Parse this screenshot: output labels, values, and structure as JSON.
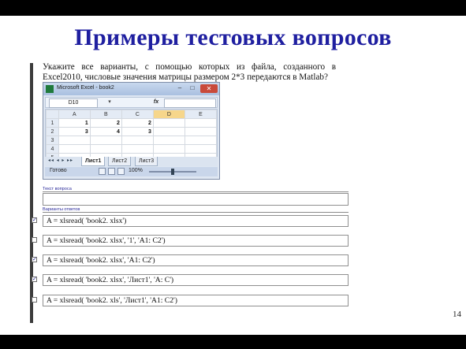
{
  "slide": {
    "title": "Примеры тестовых вопросов",
    "page_number": "14"
  },
  "question": {
    "line1": "Укажите все варианты, с помощью которых из файла, созданного в",
    "line2": "Excel2010, числовые значения матрицы размером 2*3 передаются в Matlab?"
  },
  "excel": {
    "window_title": "Microsoft Excel - book2",
    "name_box": "D10",
    "fx_label": "fx",
    "columns": [
      "A",
      "B",
      "C",
      "D",
      "E"
    ],
    "selected_column": "D",
    "rows": [
      {
        "num": "1",
        "cells": [
          "1",
          "2",
          "2",
          "",
          ""
        ]
      },
      {
        "num": "2",
        "cells": [
          "3",
          "4",
          "3",
          "",
          ""
        ]
      },
      {
        "num": "3",
        "cells": [
          "",
          "",
          "",
          "",
          ""
        ]
      },
      {
        "num": "4",
        "cells": [
          "",
          "",
          "",
          "",
          ""
        ]
      },
      {
        "num": "5",
        "cells": [
          "",
          "",
          "",
          "",
          ""
        ]
      }
    ],
    "sheet_tabs": [
      "Лист1",
      "Лист2",
      "Лист3"
    ],
    "active_sheet": "Лист1",
    "status_ready": "Готово",
    "zoom": "100%",
    "zoom_fraction": 0.5
  },
  "form": {
    "question_text_label": "Текст вопроса",
    "answers_label": "Варианты ответов",
    "answers": [
      {
        "text": "A = xlsread( 'book2. xlsx')",
        "checked": true
      },
      {
        "text": "A = xlsread( 'book2. xlsx', '1', 'A1: C2')",
        "checked": false
      },
      {
        "text": "A = xlsread( 'book2. xlsx', 'A1: C2')",
        "checked": true
      },
      {
        "text": "A = xlsread( 'book2. xlsx', 'Лист1', 'A: C')",
        "checked": true
      },
      {
        "text": "A = xlsread( 'book2. xls', 'Лист1', 'A1: C2')",
        "checked": false
      }
    ],
    "checked_mark": "✓"
  }
}
